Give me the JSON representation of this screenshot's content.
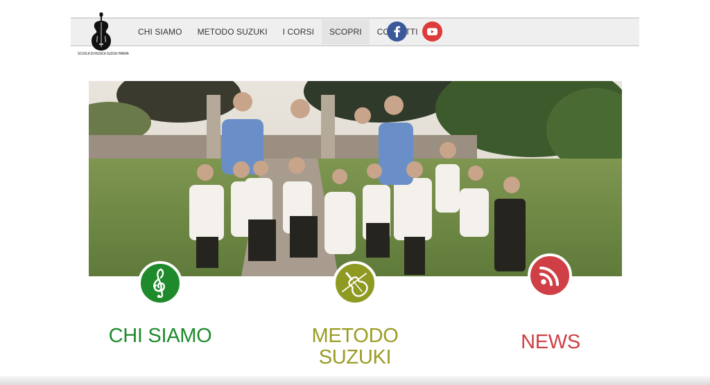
{
  "logo": {
    "text": "SCUOLA DI MUSICA SUZUKI PARMA",
    "icon": "violin-icon"
  },
  "nav": {
    "items": [
      {
        "label": "CHI SIAMO"
      },
      {
        "label": "METODO SUZUKI"
      },
      {
        "label": "I CORSI"
      },
      {
        "label": "SCOPRI"
      },
      {
        "label": "CONTATTI"
      }
    ],
    "active_index": 3
  },
  "social": {
    "facebook": {
      "icon": "facebook-icon",
      "color": "#3b5998"
    },
    "youtube": {
      "icon": "youtube-icon",
      "color": "#dd3b3b"
    }
  },
  "hero": {
    "image": "photo-of-children-in-garden"
  },
  "features": [
    {
      "title": "CHI SIAMO",
      "icon": "treble-clef-icon",
      "color": "#1f8a2c"
    },
    {
      "title_line1": "METODO",
      "title_line2": "SUZUKI",
      "icon": "violin-icon",
      "color": "#9a9b22"
    },
    {
      "title": "NEWS",
      "icon": "rss-icon",
      "color": "#cf3f45"
    }
  ]
}
